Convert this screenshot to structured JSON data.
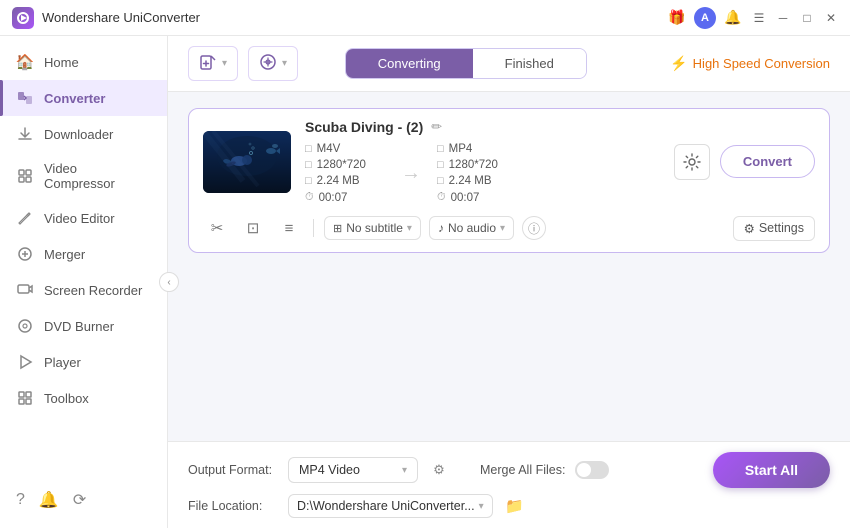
{
  "titlebar": {
    "app_name": "Wondershare UniConverter",
    "logo_color": "#7b5ea7"
  },
  "sidebar": {
    "items": [
      {
        "id": "home",
        "label": "Home",
        "icon": "🏠",
        "active": false
      },
      {
        "id": "converter",
        "label": "Converter",
        "icon": "⟳",
        "active": true
      },
      {
        "id": "downloader",
        "label": "Downloader",
        "icon": "↓",
        "active": false
      },
      {
        "id": "video-compressor",
        "label": "Video Compressor",
        "icon": "⊞",
        "active": false
      },
      {
        "id": "video-editor",
        "label": "Video Editor",
        "icon": "✂",
        "active": false
      },
      {
        "id": "merger",
        "label": "Merger",
        "icon": "⊕",
        "active": false
      },
      {
        "id": "screen-recorder",
        "label": "Screen Recorder",
        "icon": "⊙",
        "active": false
      },
      {
        "id": "dvd-burner",
        "label": "DVD Burner",
        "icon": "◎",
        "active": false
      },
      {
        "id": "player",
        "label": "Player",
        "icon": "▷",
        "active": false
      },
      {
        "id": "toolbox",
        "label": "Toolbox",
        "icon": "⊞",
        "active": false
      }
    ],
    "bottom_icons": [
      "?",
      "🔔",
      "⟳"
    ]
  },
  "toolbar": {
    "add_btn_label": "+",
    "add_files_label": "Add Files",
    "dvd_btn_label": "Add DVD",
    "tab_converting": "Converting",
    "tab_finished": "Finished",
    "speed_label": "High Speed Conversion"
  },
  "file_card": {
    "title": "Scuba Diving - (2)",
    "source": {
      "format": "M4V",
      "resolution": "1280*720",
      "size": "2.24 MB",
      "duration": "00:07"
    },
    "output": {
      "format": "MP4",
      "resolution": "1280*720",
      "size": "2.24 MB",
      "duration": "00:07"
    },
    "subtitle": "No subtitle",
    "audio": "No audio",
    "convert_btn": "Convert",
    "settings_btn": "Settings"
  },
  "bottom": {
    "output_format_label": "Output Format:",
    "output_format_value": "MP4 Video",
    "file_location_label": "File Location:",
    "file_location_value": "D:\\Wondershare UniConverter...",
    "merge_label": "Merge All Files:",
    "start_all_label": "Start All"
  }
}
